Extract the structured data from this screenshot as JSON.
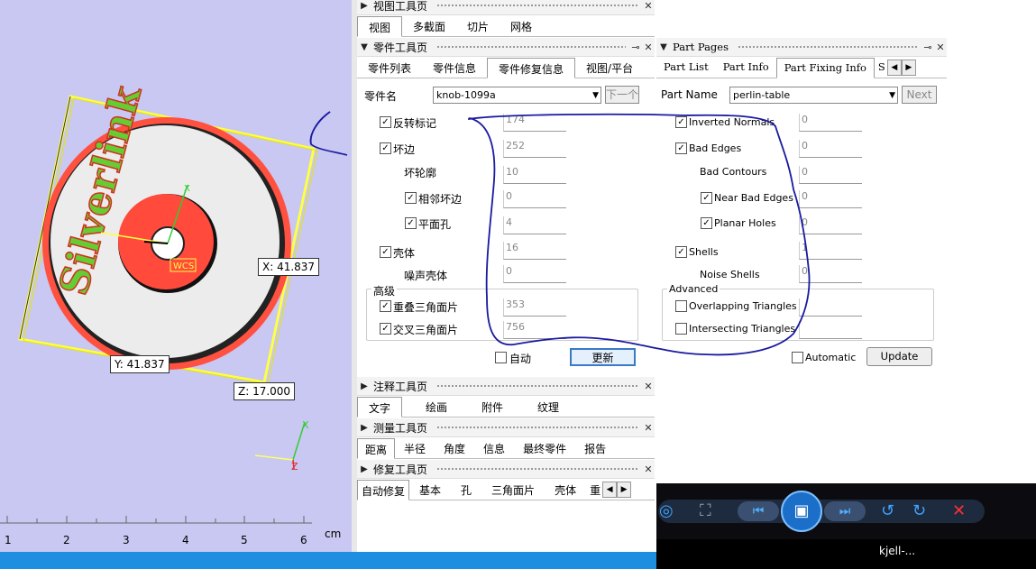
{
  "viewport": {
    "coord_x": "X: 41.837",
    "coord_y": "Y: 41.837",
    "coord_z": "Z: 17.000",
    "wcs_label": "WCS",
    "axis_x": "X",
    "axis_z": "Z",
    "model_text": "Silverlink",
    "ruler_unit": "cm",
    "ruler_labels": [
      "1",
      "2",
      "3",
      "4",
      "5",
      "6"
    ]
  },
  "view_tools": {
    "title": "视图工具页",
    "tabs": [
      "视图",
      "多截面",
      "切片",
      "网格"
    ]
  },
  "part_tools_cn": {
    "title": "零件工具页",
    "tabs": [
      "零件列表",
      "零件信息",
      "零件修复信息",
      "视图/平台"
    ],
    "part_name_label": "零件名",
    "part_name_value": "knob-1099a",
    "next_button": "下一个",
    "rows": [
      {
        "label": "反转标记",
        "value": "174",
        "checked": true
      },
      {
        "label": "坏边",
        "value": "252",
        "checked": true
      },
      {
        "label": "坏轮廓",
        "value": "10",
        "checked": null
      },
      {
        "label": "相邻坏边",
        "value": "0",
        "checked": true
      },
      {
        "label": "平面孔",
        "value": "4",
        "checked": true
      },
      {
        "label": "壳体",
        "value": "16",
        "checked": true
      },
      {
        "label": "噪声壳体",
        "value": "0",
        "checked": null
      }
    ],
    "advanced_title": "高级",
    "advanced_rows": [
      {
        "label": "重叠三角面片",
        "value": "353",
        "checked": true
      },
      {
        "label": "交叉三角面片",
        "value": "756",
        "checked": true
      }
    ],
    "auto_label": "自动",
    "update_button": "更新"
  },
  "part_pages_en": {
    "title": "Part Pages",
    "tabs": [
      "Part List",
      "Part Info",
      "Part Fixing Info",
      "S"
    ],
    "part_name_label": "Part Name",
    "part_name_value": "perlin-table",
    "next_button": "Next",
    "rows": [
      {
        "label": "Inverted Normals",
        "value": "0",
        "checked": true
      },
      {
        "label": "Bad Edges",
        "value": "0",
        "checked": true
      },
      {
        "label": "Bad Contours",
        "value": "0",
        "checked": null
      },
      {
        "label": "Near Bad Edges",
        "value": "0",
        "checked": true
      },
      {
        "label": "Planar Holes",
        "value": "0",
        "checked": true
      },
      {
        "label": "Shells",
        "value": "1",
        "checked": true
      },
      {
        "label": "Noise Shells",
        "value": "0",
        "checked": null
      }
    ],
    "advanced_title": "Advanced",
    "advanced_rows": [
      {
        "label": "Overlapping Triangles",
        "value": "",
        "checked": false
      },
      {
        "label": "Intersecting Triangles",
        "value": "",
        "checked": false
      }
    ],
    "auto_label": "Automatic",
    "update_button": "Update"
  },
  "annotation_tools": {
    "title": "注释工具页",
    "tabs": [
      "文字",
      "绘画",
      "附件",
      "纹理"
    ]
  },
  "measure_tools": {
    "title": "测量工具页",
    "tabs": [
      "距离",
      "半径",
      "角度",
      "信息",
      "最终零件",
      "报告"
    ]
  },
  "repair_tools": {
    "title": "修复工具页",
    "tabs": [
      "自动修复",
      "基本",
      "孔",
      "三角面片",
      "壳体",
      "重"
    ]
  },
  "taskbar": {
    "window_label": "kjell-..."
  },
  "colors": {
    "viewport_bg": "#c8c8f2",
    "annotation_stroke": "#1a1aa0",
    "statusbar": "#1e8fe0"
  }
}
